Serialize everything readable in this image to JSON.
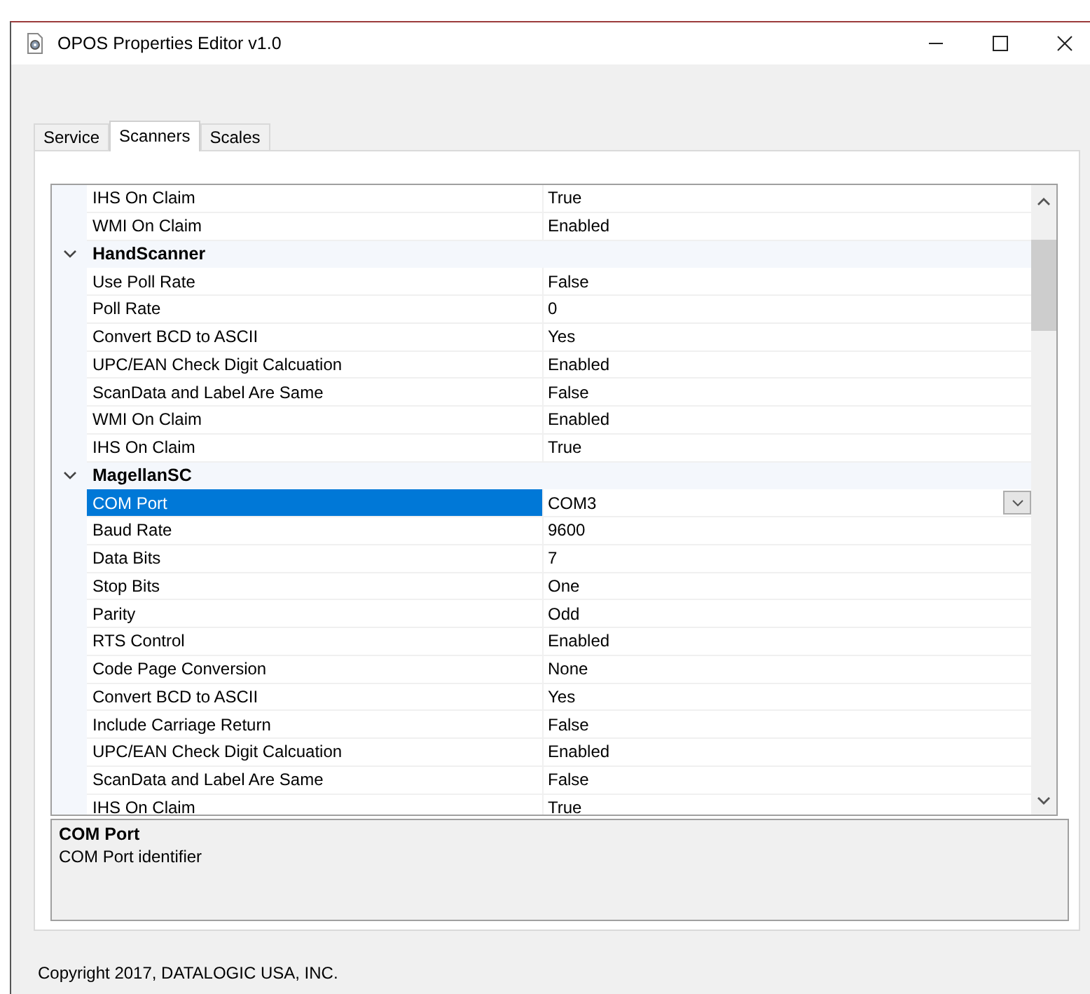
{
  "window": {
    "title": "OPOS Properties Editor  v1.0"
  },
  "tabs": [
    {
      "label": "Service",
      "selected": false
    },
    {
      "label": "Scanners",
      "selected": true
    },
    {
      "label": "Scales",
      "selected": false
    }
  ],
  "property_grid": {
    "rows": [
      {
        "kind": "property",
        "name": "IHS On Claim",
        "value": "True",
        "selected": false
      },
      {
        "kind": "property",
        "name": "WMI On Claim",
        "value": "Enabled",
        "selected": false
      },
      {
        "kind": "category",
        "name": "HandScanner",
        "expanded": true
      },
      {
        "kind": "property",
        "name": "Use Poll Rate",
        "value": "False",
        "selected": false
      },
      {
        "kind": "property",
        "name": "Poll Rate",
        "value": "0",
        "selected": false
      },
      {
        "kind": "property",
        "name": "Convert BCD to ASCII",
        "value": "Yes",
        "selected": false
      },
      {
        "kind": "property",
        "name": "UPC/EAN Check Digit Calcuation",
        "value": "Enabled",
        "selected": false
      },
      {
        "kind": "property",
        "name": "ScanData and Label Are Same",
        "value": "False",
        "selected": false
      },
      {
        "kind": "property",
        "name": "WMI On Claim",
        "value": "Enabled",
        "selected": false
      },
      {
        "kind": "property",
        "name": "IHS On Claim",
        "value": "True",
        "selected": false
      },
      {
        "kind": "category",
        "name": "MagellanSC",
        "expanded": true
      },
      {
        "kind": "property",
        "name": "COM Port",
        "value": "COM3",
        "selected": true
      },
      {
        "kind": "property",
        "name": "Baud Rate",
        "value": "9600",
        "selected": false
      },
      {
        "kind": "property",
        "name": "Data Bits",
        "value": "7",
        "selected": false
      },
      {
        "kind": "property",
        "name": "Stop Bits",
        "value": "One",
        "selected": false
      },
      {
        "kind": "property",
        "name": "Parity",
        "value": "Odd",
        "selected": false
      },
      {
        "kind": "property",
        "name": "RTS Control",
        "value": "Enabled",
        "selected": false
      },
      {
        "kind": "property",
        "name": "Code Page Conversion",
        "value": "None",
        "selected": false
      },
      {
        "kind": "property",
        "name": "Convert BCD to ASCII",
        "value": "Yes",
        "selected": false
      },
      {
        "kind": "property",
        "name": "Include Carriage Return",
        "value": "False",
        "selected": false
      },
      {
        "kind": "property",
        "name": "UPC/EAN Check Digit Calcuation",
        "value": "Enabled",
        "selected": false
      },
      {
        "kind": "property",
        "name": "ScanData and Label Are Same",
        "value": "False",
        "selected": false
      },
      {
        "kind": "property",
        "name": "IHS On Claim",
        "value": "True",
        "selected": false
      }
    ]
  },
  "description": {
    "title": "COM Port",
    "text": "COM Port identifier"
  },
  "footer": "Copyright 2017, DATALOGIC USA, INC."
}
